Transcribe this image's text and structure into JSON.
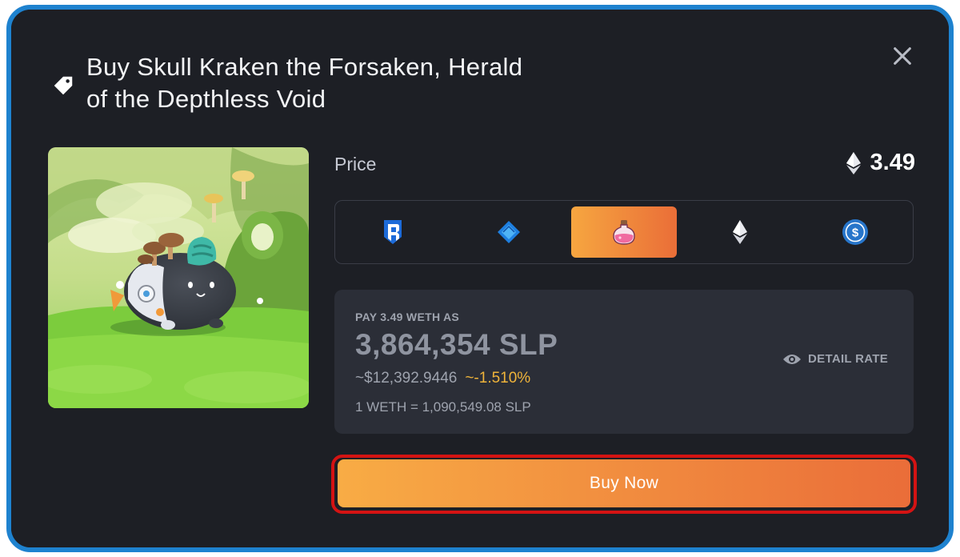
{
  "dialog": {
    "title": "Buy Skull Kraken the Forsaken, Herald of the Depthless Void",
    "close_icon": "close-icon",
    "tag_icon": "price-tag-icon"
  },
  "price": {
    "label": "Price",
    "value": "3.49",
    "currency_icon": "ethereum-icon"
  },
  "currencies": [
    {
      "name": "ronin",
      "icon": "ronin-icon",
      "selected": false
    },
    {
      "name": "axs",
      "icon": "axs-icon",
      "selected": false
    },
    {
      "name": "slp",
      "icon": "slp-potion-icon",
      "selected": true
    },
    {
      "name": "eth",
      "icon": "ethereum-icon",
      "selected": false
    },
    {
      "name": "usdc",
      "icon": "usdc-icon",
      "selected": false
    }
  ],
  "payment": {
    "pay_as_label": "PAY 3.49 WETH AS",
    "amount": "3,864,354 SLP",
    "usd_value": "~$12,392.9446",
    "change": "~-1.510%",
    "rate": "1 WETH = 1,090,549.08 SLP",
    "detail_rate_label": "DETAIL RATE"
  },
  "actions": {
    "buy_now_label": "Buy Now"
  },
  "colors": {
    "accent_start": "#f8ac45",
    "accent_end": "#ea6d39",
    "change": "#f0b43a",
    "highlight_border": "#d41313",
    "frame_border": "#1e82cf",
    "background": "#1d1f25"
  }
}
